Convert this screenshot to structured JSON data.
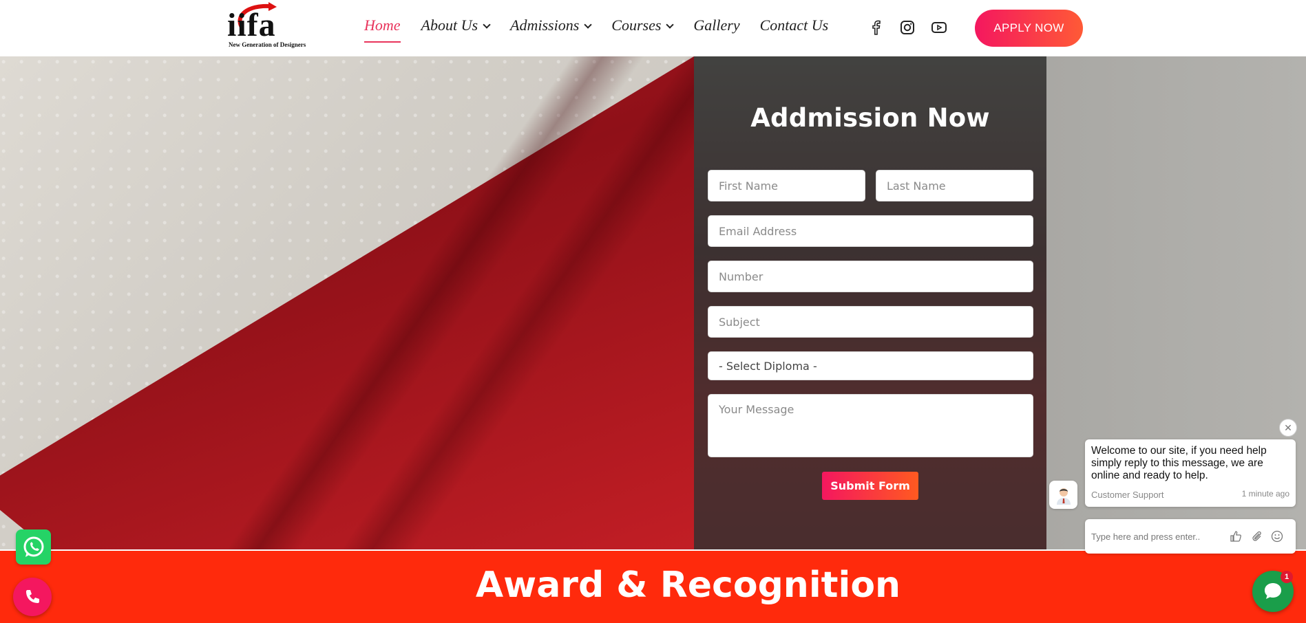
{
  "header": {
    "logo_text": "iifa",
    "logo_tagline": "New Generation of Designers",
    "nav": [
      {
        "label": "Home",
        "active": true,
        "dropdown": false
      },
      {
        "label": "About Us",
        "active": false,
        "dropdown": true
      },
      {
        "label": "Admissions",
        "active": false,
        "dropdown": true
      },
      {
        "label": "Courses",
        "active": false,
        "dropdown": true
      },
      {
        "label": "Gallery",
        "active": false,
        "dropdown": false
      },
      {
        "label": "Contact Us",
        "active": false,
        "dropdown": false
      }
    ],
    "social_icons": [
      "facebook-icon",
      "instagram-icon",
      "youtube-icon"
    ],
    "apply_label": "APPLY NOW"
  },
  "form": {
    "title": "Addmission Now",
    "first_name_placeholder": "First Name",
    "last_name_placeholder": "Last Name",
    "email_placeholder": "Email Address",
    "number_placeholder": "Number",
    "subject_placeholder": "Subject",
    "diploma_selected": "- Select Diploma -",
    "message_placeholder": "Your Message",
    "submit_label": "Submit Form"
  },
  "award": {
    "title": "Award & Recognition"
  },
  "chat": {
    "message": "Welcome to our site, if you need help simply reply to this message, we are online and ready to help.",
    "sender": "Customer Support",
    "time": "1 minute ago",
    "input_placeholder": "Type here and press enter..",
    "badge_count": "1"
  },
  "colors": {
    "accent": "#e8335b",
    "button_gradient_start": "#f4175f",
    "button_gradient_end": "#ff5a36",
    "award_band": "#ff2a0c",
    "whatsapp": "#25d366",
    "chat_launcher": "#1a9e4a"
  }
}
